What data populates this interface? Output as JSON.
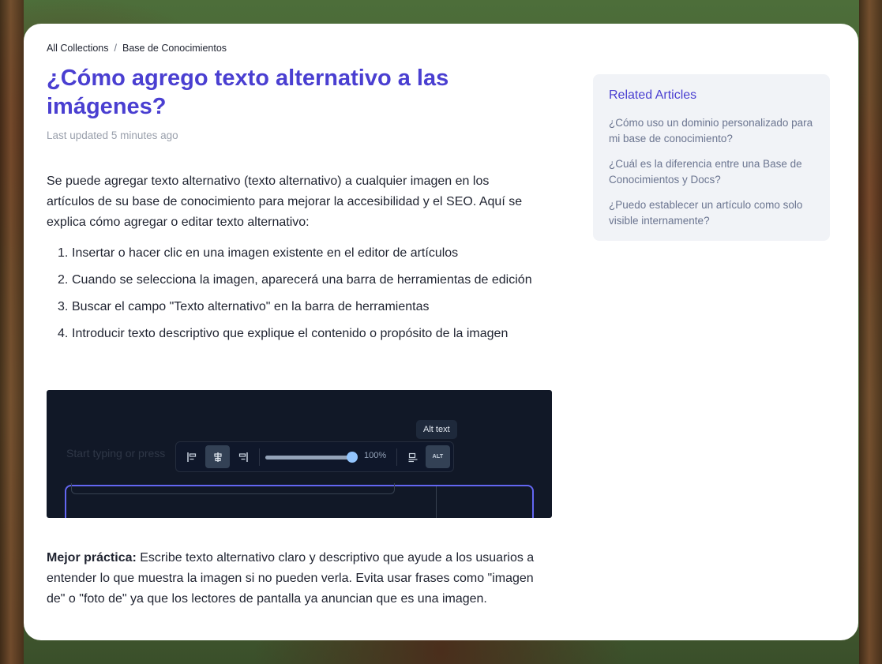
{
  "breadcrumb": {
    "root": "All Collections",
    "separator": "/",
    "current": "Base de Conocimientos"
  },
  "article": {
    "title": "¿Cómo agrego texto alternativo a las imágenes?",
    "updated": "Last updated 5 minutes ago",
    "intro": "Se puede agregar texto alternativo (texto alternativo) a cualquier imagen en los artículos de su base de conocimiento para mejorar la accesibilidad y el SEO. Aquí se explica cómo agregar o editar texto alternativo:",
    "steps": [
      {
        "num": "1.",
        "text": "Insertar o hacer clic en una imagen existente en el editor de artículos"
      },
      {
        "num": "2.",
        "text": "Cuando se selecciona la imagen, aparecerá una barra de herramientas de edición"
      },
      {
        "num": "3.",
        "text": "Buscar el campo \"Texto alternativo\" en la barra de herramientas"
      },
      {
        "num": "4.",
        "text": "Introducir texto descriptivo que explique el contenido o propósito de la imagen"
      }
    ],
    "tip_label": "Mejor práctica:",
    "tip_text": " Escribe texto alternativo claro y descriptivo que ayude a los usuarios a entender lo que muestra la imagen si no pueden verla. Evita usar frases como \"imagen de\" o \"foto de\" ya que los lectores de pantalla ya anuncian que es una imagen."
  },
  "screenshot": {
    "placeholder": "Start typing or press",
    "tooltip": "Alt text",
    "zoom": "100%",
    "slider_level": 1.0,
    "alt_badge": "ALT",
    "icons": [
      "align-left-icon",
      "align-center-icon",
      "align-right-icon",
      "wrap-text-icon",
      "alt-text-icon"
    ]
  },
  "related": {
    "heading": "Related Articles",
    "items": [
      "¿Cómo uso un dominio personalizado para mi base de conocimiento?",
      "¿Cuál es la diferencia entre una Base de Conocimientos y Docs?",
      "¿Puedo establecer un artículo como solo visible internamente?"
    ]
  },
  "colors": {
    "accent": "#4a3fd1",
    "text": "#1f2330",
    "muted": "#9aa0ac",
    "frame": "#6366f1"
  }
}
